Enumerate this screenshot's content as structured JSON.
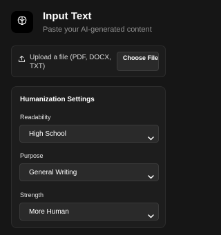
{
  "header": {
    "title": "Input Text",
    "subtitle": "Paste your AI-generated content",
    "logo_icon": "brain-icon"
  },
  "upload": {
    "icon": "upload-icon",
    "label": "Upload a file (PDF, DOCX, TXT)",
    "button_label": "Choose File"
  },
  "settings": {
    "title": "Humanization Settings",
    "fields": [
      {
        "label": "Readability",
        "value": "High School"
      },
      {
        "label": "Purpose",
        "value": "General Writing"
      },
      {
        "label": "Strength",
        "value": "More Human"
      }
    ]
  },
  "colors": {
    "background": "#161616",
    "card": "#1d1d1d",
    "border": "#2c2c2c",
    "muted_text": "#8f8f8f"
  }
}
